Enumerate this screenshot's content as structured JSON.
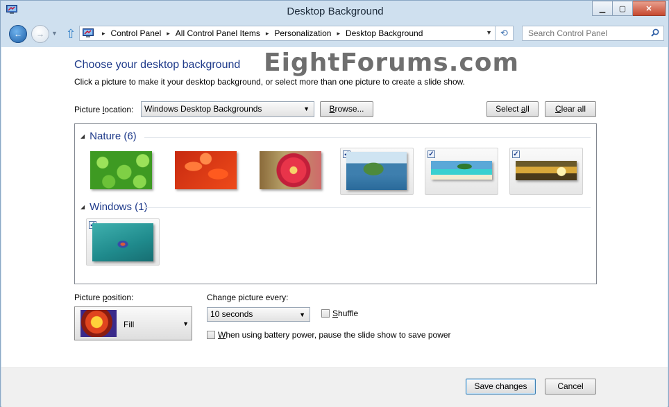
{
  "window": {
    "title": "Desktop Background",
    "min_glyph": "▁",
    "max_glyph": "▢",
    "close_glyph": "✕"
  },
  "nav": {
    "back_glyph": "←",
    "forward_glyph": "→",
    "recent_glyph": "▼",
    "up_glyph": "⇧",
    "breadcrumbs": [
      "Control Panel",
      "All Control Panel Items",
      "Personalization",
      "Desktop Background"
    ],
    "breadcrumb_sep": "▸",
    "address_dropdown_glyph": "▼",
    "refresh_glyph": "⟲",
    "search_placeholder": "Search Control Panel"
  },
  "watermark": "EightForums.com",
  "heading": "Choose your desktop background",
  "subtext": "Click a picture to make it your desktop background, or select more than one picture to create a slide show.",
  "location": {
    "label_pre": "Picture ",
    "label_u": "l",
    "label_post": "ocation:",
    "value": "Windows Desktop Backgrounds",
    "browse_pre": "",
    "browse_u": "B",
    "browse_post": "rowse...",
    "select_all_pre": "Select ",
    "select_all_u": "a",
    "select_all_post": "ll",
    "clear_all_pre": "",
    "clear_all_u": "C",
    "clear_all_post": "lear all"
  },
  "groups": [
    {
      "label": "Nature (6)",
      "items": [
        {
          "name": "clover",
          "checked": false
        },
        {
          "name": "red-leaves",
          "checked": false
        },
        {
          "name": "pink-flower",
          "checked": false
        },
        {
          "name": "green-island",
          "checked": true
        },
        {
          "name": "tropical-beach",
          "checked": true
        },
        {
          "name": "golden-sunset",
          "checked": true
        }
      ]
    },
    {
      "label": "Windows (1)",
      "items": [
        {
          "name": "betta-fish",
          "checked": true
        }
      ]
    }
  ],
  "collapse_glyph": "◢",
  "check_glyph": "✓",
  "combo_glyph": "▼",
  "position": {
    "label_pre": "Picture ",
    "label_u": "p",
    "label_post": "osition:",
    "value": "Fill"
  },
  "interval": {
    "label_pre": "Chan",
    "label_u": "g",
    "label_post": "e picture every:",
    "value": "10 seconds"
  },
  "shuffle": {
    "u": "S",
    "rest": "huffle",
    "checked": false
  },
  "battery": {
    "u": "W",
    "rest": "hen using battery power, pause the slide show to save power",
    "checked": false
  },
  "footer": {
    "save": "Save changes",
    "cancel": "Cancel"
  },
  "colors": {
    "heading": "#1e3a8a",
    "window_frame": "#cfe0ef",
    "close_button": "#c64930"
  }
}
